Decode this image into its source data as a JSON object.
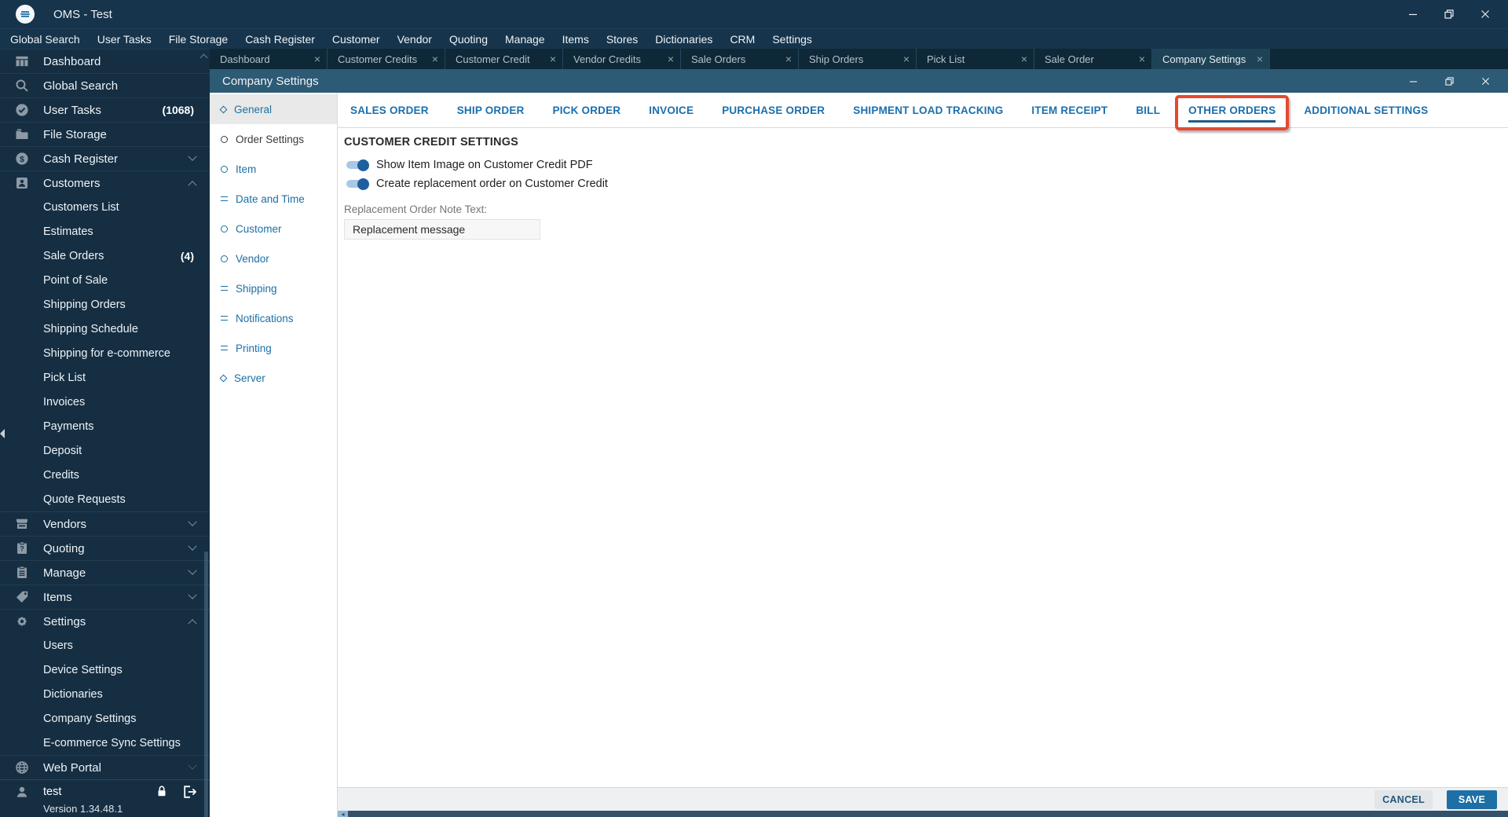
{
  "titlebar": {
    "title": "OMS - Test",
    "logo_icon": "oms-logo-icon",
    "controls": [
      "minimize",
      "maximize",
      "close"
    ]
  },
  "menu_bar": {
    "items": [
      "Global Search",
      "User Tasks",
      "File Storage",
      "Cash Register",
      "Customer",
      "Vendor",
      "Quoting",
      "Manage",
      "Items",
      "Stores",
      "Dictionaries",
      "CRM",
      "Settings"
    ]
  },
  "tab_bar": {
    "close_icon_glyph": "×",
    "active": "Company Settings",
    "tabs": [
      "Dashboard",
      "Customer Credits",
      "Customer Credit",
      "Vendor Credits",
      "Sale Orders",
      "Ship Orders",
      "Pick List",
      "Sale Order",
      "Company Settings"
    ]
  },
  "sidebar": {
    "items": [
      {
        "label": "Dashboard",
        "icon": "dashboard",
        "level": 0
      },
      {
        "label": "Global Search",
        "icon": "search",
        "level": 0
      },
      {
        "label": "User Tasks",
        "icon": "tasks",
        "level": 0,
        "badge": "(1068)"
      },
      {
        "label": "File Storage",
        "icon": "storage",
        "level": 0
      },
      {
        "label": "Cash Register",
        "icon": "cash",
        "level": 0,
        "chevron": "down"
      },
      {
        "label": "Customers",
        "icon": "customers",
        "level": 0,
        "chevron": "up"
      },
      {
        "label": "Customers List",
        "level": 1
      },
      {
        "label": "Estimates",
        "level": 1
      },
      {
        "label": "Sale Orders",
        "level": 1,
        "badge": "(4)"
      },
      {
        "label": "Point of Sale",
        "level": 1
      },
      {
        "label": "Shipping Orders",
        "level": 1
      },
      {
        "label": "Shipping Schedule",
        "level": 1
      },
      {
        "label": "Shipping for e-commerce",
        "level": 1
      },
      {
        "label": "Pick List",
        "level": 1
      },
      {
        "label": "Invoices",
        "level": 1
      },
      {
        "label": "Payments",
        "level": 1
      },
      {
        "label": "Deposit",
        "level": 1
      },
      {
        "label": "Credits",
        "level": 1
      },
      {
        "label": "Quote Requests",
        "level": 1
      },
      {
        "label": "Vendors",
        "icon": "vendors",
        "level": 0,
        "chevron": "down"
      },
      {
        "label": "Quoting",
        "icon": "quoting",
        "level": 0,
        "chevron": "down"
      },
      {
        "label": "Manage",
        "icon": "manage",
        "level": 0,
        "chevron": "down"
      },
      {
        "label": "Items",
        "icon": "items",
        "level": 0,
        "chevron": "down"
      },
      {
        "label": "Settings",
        "icon": "settings",
        "level": 0,
        "chevron": "up"
      },
      {
        "label": "Users",
        "level": 1
      },
      {
        "label": "Device Settings",
        "level": 1
      },
      {
        "label": "Dictionaries",
        "level": 1
      },
      {
        "label": "Company Settings",
        "level": 1
      },
      {
        "label": "E-commerce Sync Settings",
        "level": 1
      },
      {
        "label": "Web Portal",
        "icon": "globe",
        "level": 0,
        "chevron": "down",
        "chevron_dim": true
      }
    ],
    "user": {
      "name": "test",
      "icon": "user",
      "action_icons": [
        "lock",
        "signout"
      ]
    },
    "version": "Version 1.34.48.1"
  },
  "company_settings_window": {
    "title": "Company Settings",
    "controls": [
      "minimize",
      "restore",
      "close"
    ],
    "nav": {
      "items": [
        {
          "label": "General",
          "icon": "diamond",
          "gray": true
        },
        {
          "label": "Order Settings",
          "icon": "circle",
          "current": true
        },
        {
          "label": "Item",
          "icon": "circle"
        },
        {
          "label": "Date and Time",
          "icon": "equals"
        },
        {
          "label": "Customer",
          "icon": "circle"
        },
        {
          "label": "Vendor",
          "icon": "circle"
        },
        {
          "label": "Shipping",
          "icon": "equals"
        },
        {
          "label": "Notifications",
          "icon": "equals"
        },
        {
          "label": "Printing",
          "icon": "equals"
        },
        {
          "label": "Server",
          "icon": "diamond"
        }
      ]
    },
    "tabs": {
      "items": [
        "SALES ORDER",
        "SHIP ORDER",
        "PICK ORDER",
        "INVOICE",
        "PURCHASE ORDER",
        "SHIPMENT LOAD TRACKING",
        "ITEM RECEIPT",
        "BILL",
        "OTHER ORDERS",
        "ADDITIONAL SETTINGS"
      ],
      "selected": "OTHER ORDERS",
      "highlighted": "OTHER ORDERS",
      "highlight_color": "#e5492f"
    },
    "content": {
      "section_title": "CUSTOMER CREDIT SETTINGS",
      "toggles": [
        {
          "label": "Show Item Image on Customer Credit PDF",
          "on": true
        },
        {
          "label": "Create replacement order on Customer Credit",
          "on": true
        }
      ],
      "note_label": "Replacement Order Note Text:",
      "note_value": "Replacement message"
    },
    "footer": {
      "cancel_label": "CANCEL",
      "save_label": "SAVE"
    }
  },
  "colors": {
    "titlebar_bg": "#16344c",
    "tabstrip_bg": "#0e2838",
    "sidebar_bg": "#152e42",
    "window_header_bg": "#2d5a74",
    "accent_blue": "#1d6fa5",
    "tab_text_blue": "#1a6fae",
    "toggle_pill": "#a9c7e7",
    "toggle_knob": "#1d5f9f",
    "highlight_red": "#e5492f"
  }
}
